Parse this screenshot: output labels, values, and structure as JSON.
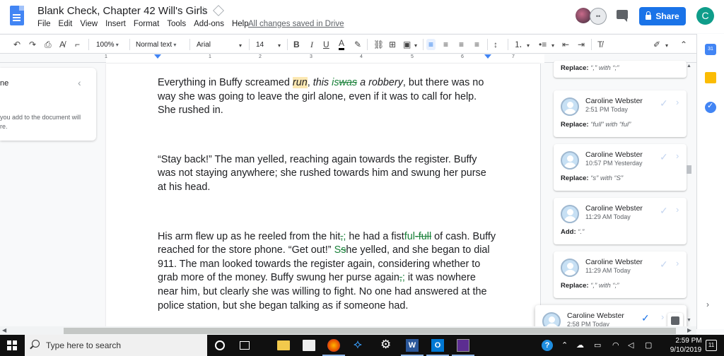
{
  "header": {
    "title": "Blank Check, Chapter 42 Will's Girls",
    "menu": [
      "File",
      "Edit",
      "View",
      "Insert",
      "Format",
      "Tools",
      "Add-ons",
      "Help"
    ],
    "save_status": "All changes saved in Drive",
    "share_label": "Share",
    "user_initial": "C",
    "anon_label": "••"
  },
  "toolbar": {
    "zoom": "100%",
    "style": "Normal text",
    "font": "Arial",
    "size": "14",
    "bold": "B",
    "italic": "I",
    "underline": "U",
    "text_color": "A"
  },
  "ruler": {
    "numbers": [
      "1",
      "1",
      "2",
      "3",
      "4",
      "5",
      "6",
      "7"
    ]
  },
  "outline": {
    "title": "ne",
    "hint": "you add to the document will\nre."
  },
  "document": {
    "p1": {
      "a": "Everything in Buffy screamed ",
      "hl": "run",
      "b": ", ",
      "c": "this ",
      "ins": "is",
      "del": "was",
      "d": " a robbery",
      "e": ", but there was no way she was going to leave the girl alone, even if it was to call for help. She rushed in."
    },
    "p2": "“Stay back!” The man yelled, reaching again towards the register. Buffy was not staying anywhere; she rushed towards him and swung her purse at his head.",
    "p3": {
      "a": "His arm flew up as he reeled from the hit",
      "del1": ",",
      "ins1": ";",
      "b": " he had a fist",
      "ins2": "ful",
      "del2": "-full",
      "c": " of cash. Buffy reached for the store phone. “Get out!” ",
      "ins3": "S",
      "del3": "s",
      "d": "he yelled, and she began to dial 911. The man looked towards the register again, considering whether to grab more of the money. Buffy swung her purse again",
      "del4": ",",
      "ins4": ";",
      "e": " it was nowhere near him, but clearly she was willing to fight. No one had answered at the police station, but she began talking as if someone had."
    }
  },
  "comments": [
    {
      "name": "",
      "time": "",
      "action_label": "Replace:",
      "action_detail": "“,” with “;”"
    },
    {
      "name": "Caroline Webster",
      "time": "2:51 PM Today",
      "action_label": "Replace:",
      "action_detail": "“full” with “ful”"
    },
    {
      "name": "Caroline Webster",
      "time": "10:57 PM Yesterday",
      "action_label": "Replace:",
      "action_detail": "“s” with “S”"
    },
    {
      "name": "Caroline Webster",
      "time": "11:29 AM Today",
      "action_label": "Add:",
      "action_detail": "“.”"
    },
    {
      "name": "Caroline Webster",
      "time": "11:29 AM Today",
      "action_label": "Replace:",
      "action_detail": "“,” with “;”"
    },
    {
      "name": "Caroline Webster",
      "time": "2:58 PM Today",
      "action_label": "",
      "action_detail": ""
    }
  ],
  "side_panel": {
    "calendar_label": "31"
  },
  "taskbar": {
    "search_placeholder": "Type here to search",
    "time": "2:59 PM",
    "date": "9/10/2019",
    "notifications": "11",
    "word_label": "W",
    "outlook_label": "O"
  },
  "colors": {
    "accent": "#1a73e8",
    "suggestion_green": "#188038",
    "highlight": "#fce8b2",
    "avatar": "#0f9d8a"
  }
}
